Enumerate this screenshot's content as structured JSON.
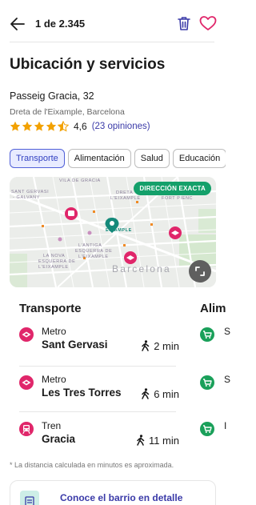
{
  "header": {
    "counter": "1 de 2.345",
    "back_icon": "arrow-left-icon",
    "delete_icon": "trash-icon",
    "favorite_icon": "heart-outline-icon",
    "accent_color": "#e0266a"
  },
  "location": {
    "title": "Ubicación y servicios",
    "street": "Passeig Gracia, 32",
    "district": "Dreta de l'Eixample, Barcelona",
    "rating": {
      "value": "4,6",
      "stars": 4.5,
      "reviews": "(23 opiniones)"
    }
  },
  "chips": [
    {
      "label": "Transporte",
      "active": true
    },
    {
      "label": "Alimentación",
      "active": false
    },
    {
      "label": "Salud",
      "active": false
    },
    {
      "label": "Educación",
      "active": false
    }
  ],
  "map": {
    "badge": "DIRECCIÓN EXACTA",
    "labels": {
      "vila_de_gracia": "VILA DE GRÀCIA",
      "sant_gervasi_1": "SANT GERVASI",
      "sant_gervasi_2": "- GALVANY",
      "dreta_1": "DRETA",
      "dreta_2": "L'EIXAMPLE",
      "fort_pienc": "FORT PIENC",
      "eixample": "EIXAMPLE",
      "antiga_1": "L'ANTIGA",
      "antiga_2": "ESQUERRA DE",
      "antiga_3": "L'EIXAMPLE",
      "nova_1": "LA NOVA",
      "nova_2": "ESQUERRA DE",
      "nova_3": "L'EIXAMPLE"
    },
    "city_label": "Barcelona",
    "expand_icon": "expand-icon",
    "pin_color": "#14897a",
    "badge_color": "#14a06a"
  },
  "transport": {
    "title": "Transporte",
    "stops": [
      {
        "type": "Metro",
        "name": "Sant Gervasi",
        "time": "2 min",
        "icon": "metro-icon"
      },
      {
        "type": "Metro",
        "name": "Les Tres Torres",
        "time": "6 min",
        "icon": "metro-icon"
      },
      {
        "type": "Tren",
        "name": "Gracia",
        "time": "11 min",
        "icon": "train-icon"
      }
    ]
  },
  "food": {
    "title": "Alim",
    "letters": [
      "S",
      "S",
      "I"
    ],
    "icon": "cart-icon",
    "icon_color": "#1aa05a"
  },
  "footnote": "* La distancia calculada en minutos es aproximada.",
  "promo": {
    "title": "Conoce el barrio en detalle"
  }
}
